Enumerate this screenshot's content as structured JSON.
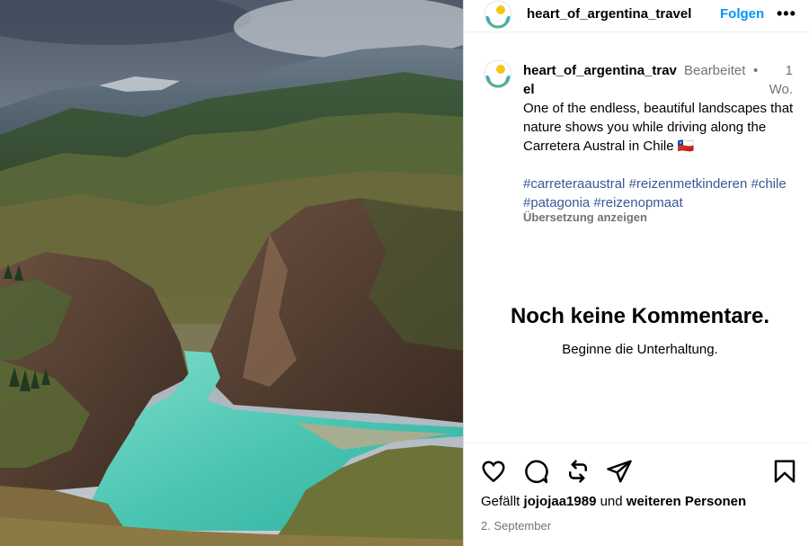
{
  "post": {
    "username": "heart_of_argentina_travel",
    "follow_label": "Folgen",
    "more_label": "•••",
    "caption": {
      "username": "heart_of_argentina_travel",
      "edited_label": "Bearbeitet",
      "separator": "•",
      "time": "1 Wo.",
      "text": "One of the endless, beautiful landscapes that nature shows you while driving along the Carretera Austral in Chile 🇨🇱",
      "hashtags": [
        "#carreteraaustral",
        "#reizenmetkinderen",
        "#chile",
        "#patagonia",
        "#reizenopmaat"
      ],
      "translate_label": "Übersetzung anzeigen"
    },
    "comments": {
      "empty_title": "Noch keine Kommentare.",
      "empty_subtitle": "Beginne die Unterhaltung."
    },
    "likes": {
      "prefix": "Gefällt",
      "user": "jojojaa1989",
      "middle": "und",
      "suffix": "weiteren Personen"
    },
    "date": "2. September",
    "icons": [
      "heart-icon",
      "comment-icon",
      "repost-icon",
      "share-icon",
      "bookmark-icon"
    ],
    "colors": {
      "follow": "#0095f6",
      "hashtag": "#385898",
      "muted": "#737373",
      "river": "#4fc9b8"
    }
  }
}
